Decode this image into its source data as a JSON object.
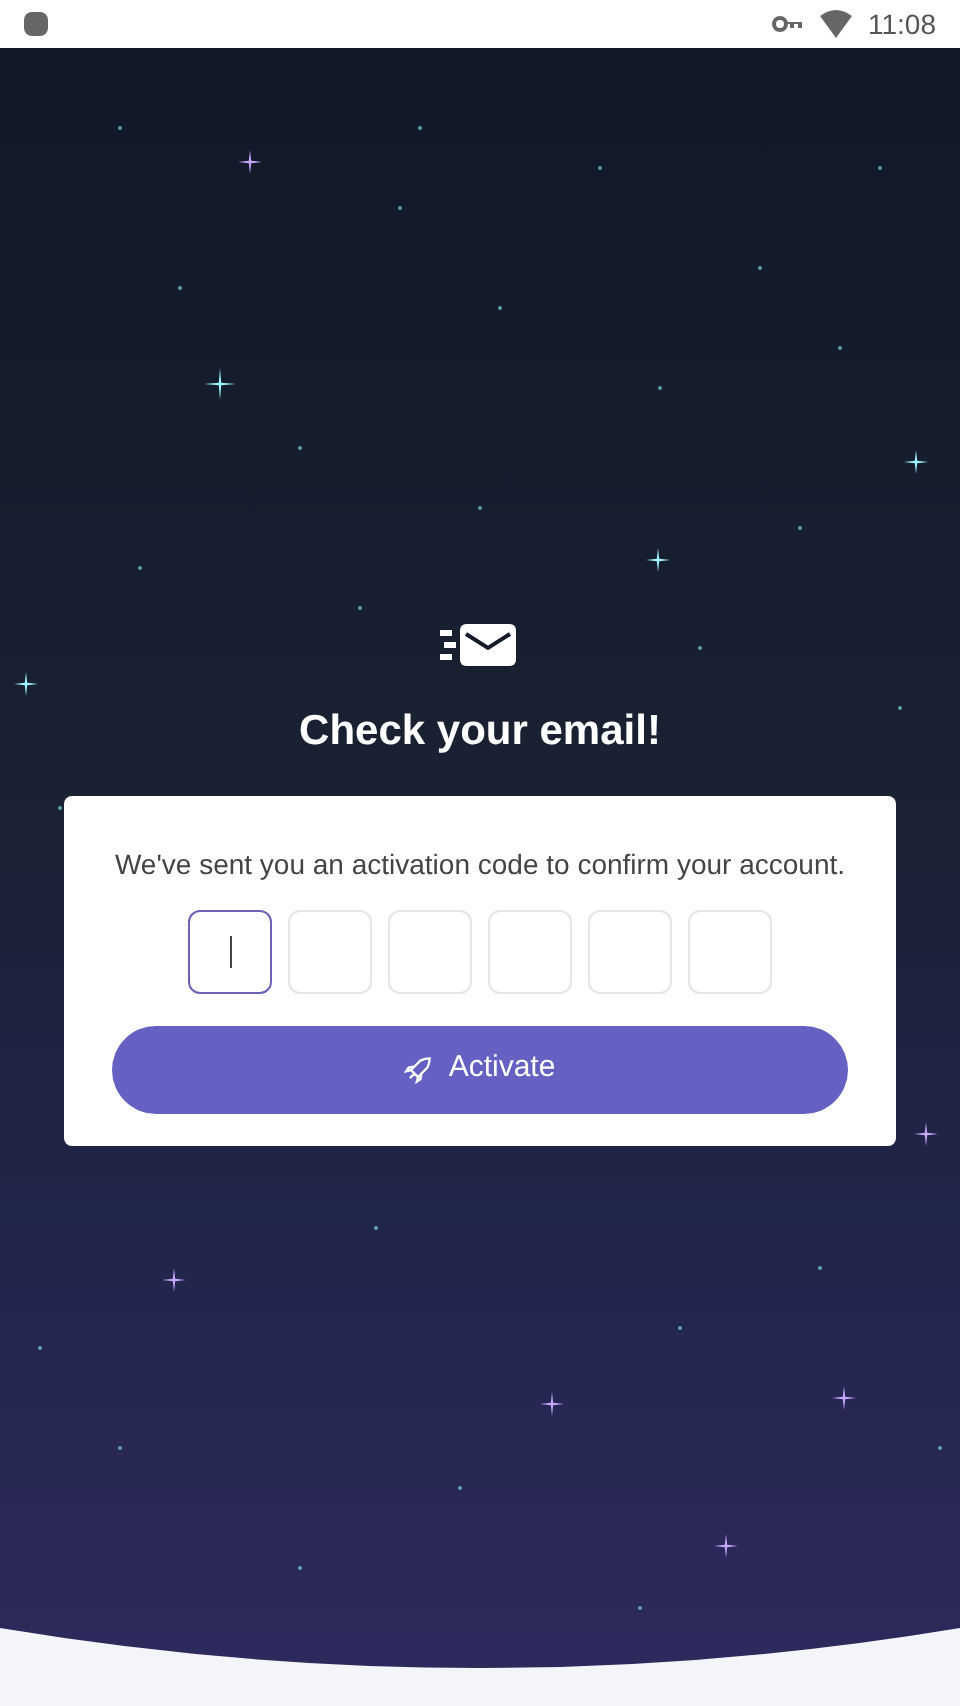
{
  "status_bar": {
    "time": "11:08"
  },
  "title": "Check your email!",
  "card": {
    "message": "We've sent you an activation code to confirm your account.",
    "code_boxes": [
      {
        "selected": true
      },
      {
        "selected": false
      },
      {
        "selected": false
      },
      {
        "selected": false
      },
      {
        "selected": false
      },
      {
        "selected": false
      }
    ],
    "button": "Activate"
  }
}
